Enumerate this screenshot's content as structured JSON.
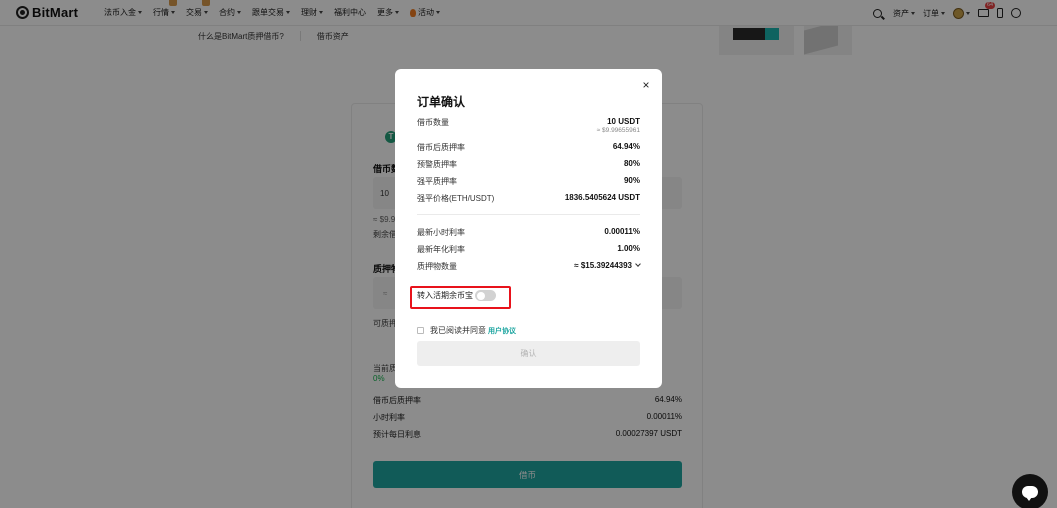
{
  "nav": {
    "logo": "BitMart",
    "items": [
      {
        "label": "法币入金",
        "caret": true
      },
      {
        "label": "行情",
        "caret": true,
        "badge": true
      },
      {
        "label": "交易",
        "caret": true,
        "badge": true
      },
      {
        "label": "合约",
        "caret": true
      },
      {
        "label": "跟单交易",
        "caret": true
      },
      {
        "label": "理财",
        "caret": true
      },
      {
        "label": "福利中心",
        "caret": false
      },
      {
        "label": "更多",
        "caret": true
      }
    ],
    "activity": "活动",
    "right": {
      "assets": "资产",
      "orders": "订单",
      "mail_badge": "64"
    }
  },
  "page": {
    "crumbs": [
      "什么是BitMart质押借币?",
      "借币资产"
    ],
    "coin_symbol": "T",
    "borrow_label": "借币数",
    "borrow_input": "10",
    "approx_value": "≈ $9.9",
    "remaining": "剩余借",
    "collateral_label": "质押物",
    "collateral_input": "≈",
    "collateral_available": "可质押",
    "current_label": "当前质",
    "current_value": "0%",
    "rows": [
      {
        "label": "借币后质押率",
        "value": "64.94%"
      },
      {
        "label": "小时利率",
        "value": "0.00011%"
      },
      {
        "label": "预计每日利息",
        "value": "0.00027397 USDT"
      }
    ],
    "submit": "借币"
  },
  "modal": {
    "title": "订单确认",
    "borrow_amount": {
      "label": "借币数量",
      "value": "10 USDT",
      "sub": "≈ $9.99655961"
    },
    "ltv_after": {
      "label": "借币后质押率",
      "value": "64.94%"
    },
    "warning_ltv": {
      "label": "预警质押率",
      "value": "80%"
    },
    "liquidation_ltv": {
      "label": "强平质押率",
      "value": "90%"
    },
    "liquidation_price": {
      "label": "强平价格(ETH/USDT)",
      "value": "1836.5405624 USDT"
    },
    "hourly_rate": {
      "label": "最新小时利率",
      "value": "0.00011%"
    },
    "annual_rate": {
      "label": "最新年化利率",
      "value": "1.00%"
    },
    "collateral_amount": {
      "label": "质押物数量",
      "value": "≈ $15.39244393"
    },
    "toggle_label": "转入活期余币宝",
    "agree_text": "我已阅读并同意",
    "agree_link": "用户协议",
    "confirm": "确认",
    "close": "×"
  },
  "colors": {
    "accent": "#1fa6a1",
    "positive": "#0fb24a",
    "highlight": "#e8121b"
  }
}
